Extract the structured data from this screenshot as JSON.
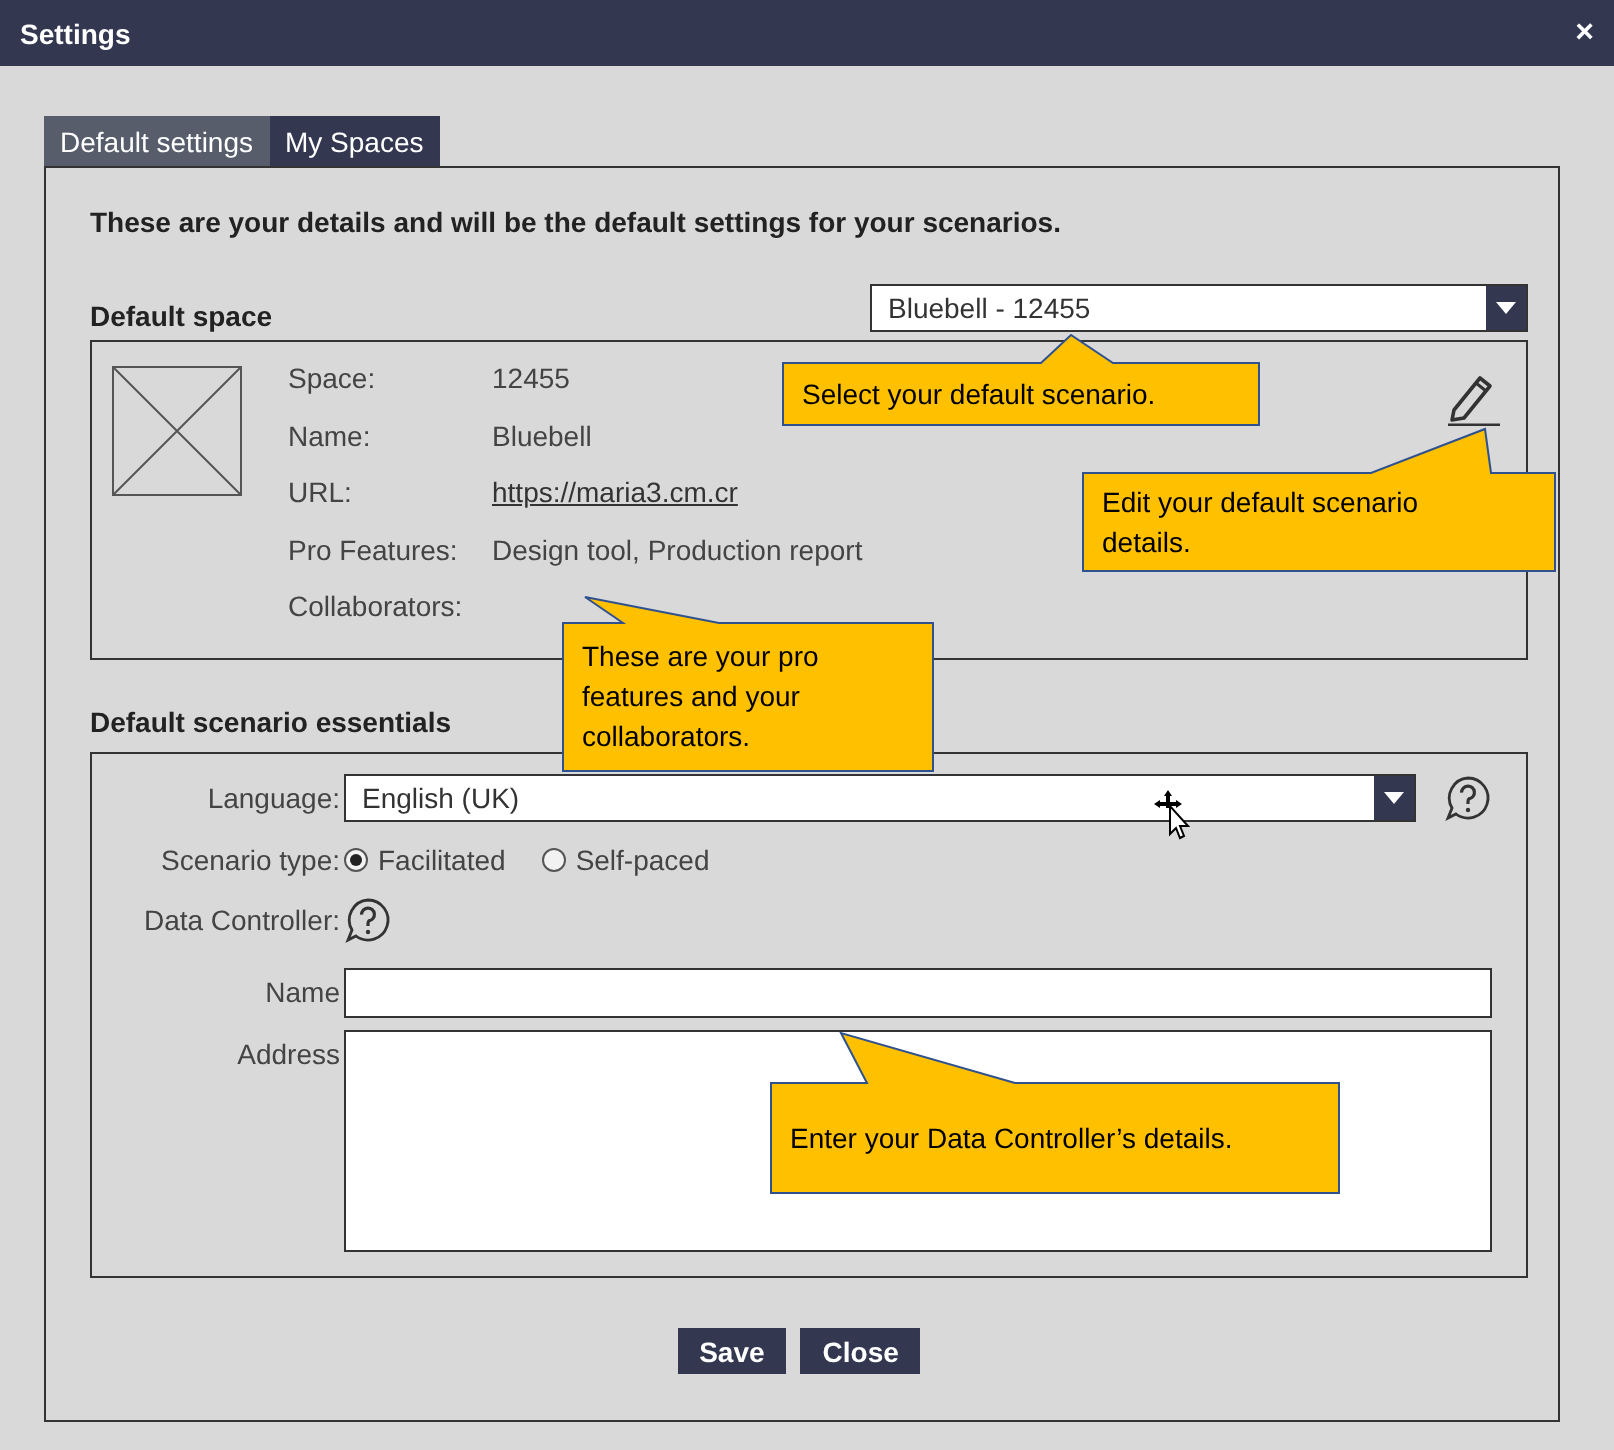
{
  "window": {
    "title": "Settings",
    "close": "×"
  },
  "tabs": [
    {
      "label": "Default settings",
      "selected": true
    },
    {
      "label": "My Spaces",
      "selected": false
    }
  ],
  "intro": "These are your details and will be the default settings for your scenarios.",
  "default_space": {
    "label": "Default space",
    "dropdown": {
      "value": "Bluebell - 12455"
    },
    "details": [
      {
        "label": "Space:",
        "value": "12455",
        "kind": "text"
      },
      {
        "label": "Name:",
        "value": "Bluebell",
        "kind": "text"
      },
      {
        "label": "URL:",
        "value": "https://maria3.cm.cr",
        "kind": "link"
      },
      {
        "label": "Pro Features:",
        "value": "Design tool, Production report",
        "kind": "text"
      },
      {
        "label": "Collaborators:",
        "kind": "text"
      }
    ]
  },
  "essentials": {
    "label": "Default scenario essentials",
    "language": {
      "label": "Language:",
      "value": "English (UK)"
    },
    "scenario_type": {
      "label": "Scenario type:",
      "options": [
        {
          "label": "Facilitated",
          "selected": true
        },
        {
          "label": "Self-paced",
          "selected": false
        }
      ]
    },
    "data_controller": {
      "label": "Data Controller:",
      "name": {
        "label": "Name"
      },
      "address": {
        "label": "Address"
      }
    }
  },
  "buttons": [
    "Save",
    "Close"
  ],
  "callouts": [
    "Select your default scenario.",
    "Edit your default scenario details.",
    "These are your pro features and your collaborators.",
    "Enter your Data Controller’s details."
  ]
}
